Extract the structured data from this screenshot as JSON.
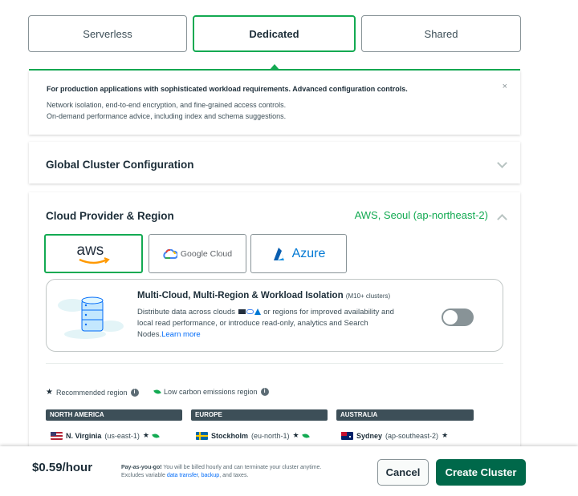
{
  "tiers": [
    {
      "label": "Serverless",
      "active": false
    },
    {
      "label": "Dedicated",
      "active": true
    },
    {
      "label": "Shared",
      "active": false
    }
  ],
  "description": {
    "title": "For production applications with sophisticated workload requirements. Advanced configuration controls.",
    "lines": [
      "Network isolation, end-to-end encryption, and fine-grained access controls.",
      "On-demand performance advice, including index and schema suggestions."
    ],
    "close_glyph": "×"
  },
  "global_config": {
    "title": "Global Cluster Configuration"
  },
  "cloud": {
    "title": "Cloud Provider & Region",
    "selected_region": "AWS, Seoul (ap-northeast-2)",
    "providers": [
      {
        "label": "aws",
        "active": true
      },
      {
        "label": "Google Cloud",
        "active": false
      },
      {
        "label": "Azure",
        "active": false
      }
    ],
    "multi": {
      "title": "Multi-Cloud, Multi-Region & Workload Isolation",
      "badge": "(M10+ clusters)",
      "line1_a": "Distribute data across clouds",
      "line1_b": "or regions for improved availability and",
      "line2": "local read performance, or introduce read-only, analytics and Search",
      "line3": "Nodes.",
      "learn_more": "Learn more",
      "toggle_on": false
    },
    "legend": {
      "recommended": "Recommended region",
      "low_carbon": "Low carbon emissions region",
      "star_glyph": "★",
      "info_glyph": "i"
    },
    "continents": [
      {
        "label": "NORTH AMERICA"
      },
      {
        "label": "EUROPE"
      },
      {
        "label": "AUSTRALIA"
      }
    ],
    "regions": [
      {
        "name": "N. Virginia",
        "code": "(us-east-1)",
        "flag_color": "#b22234"
      },
      {
        "name": "Stockholm",
        "code": "(eu-north-1)",
        "flag_color": "#006aa7"
      },
      {
        "name": "Sydney",
        "code": "(ap-southeast-2)",
        "flag_color": "#012169"
      }
    ]
  },
  "footer": {
    "price": "$0.59/hour",
    "note_bold": "Pay-as-you-go!",
    "note_1": " You will be billed hourly and can terminate your cluster anytime.",
    "note_2a": "Excludes variable ",
    "note_2_link1": "data transfer",
    "note_2b": ", ",
    "note_2_link2": "backup",
    "note_2c": ", and taxes.",
    "cancel_label": "Cancel",
    "create_label": "Create Cluster"
  },
  "colors": {
    "accent": "#13aa52",
    "primary_button": "#00684a",
    "link": "#016bf8"
  }
}
